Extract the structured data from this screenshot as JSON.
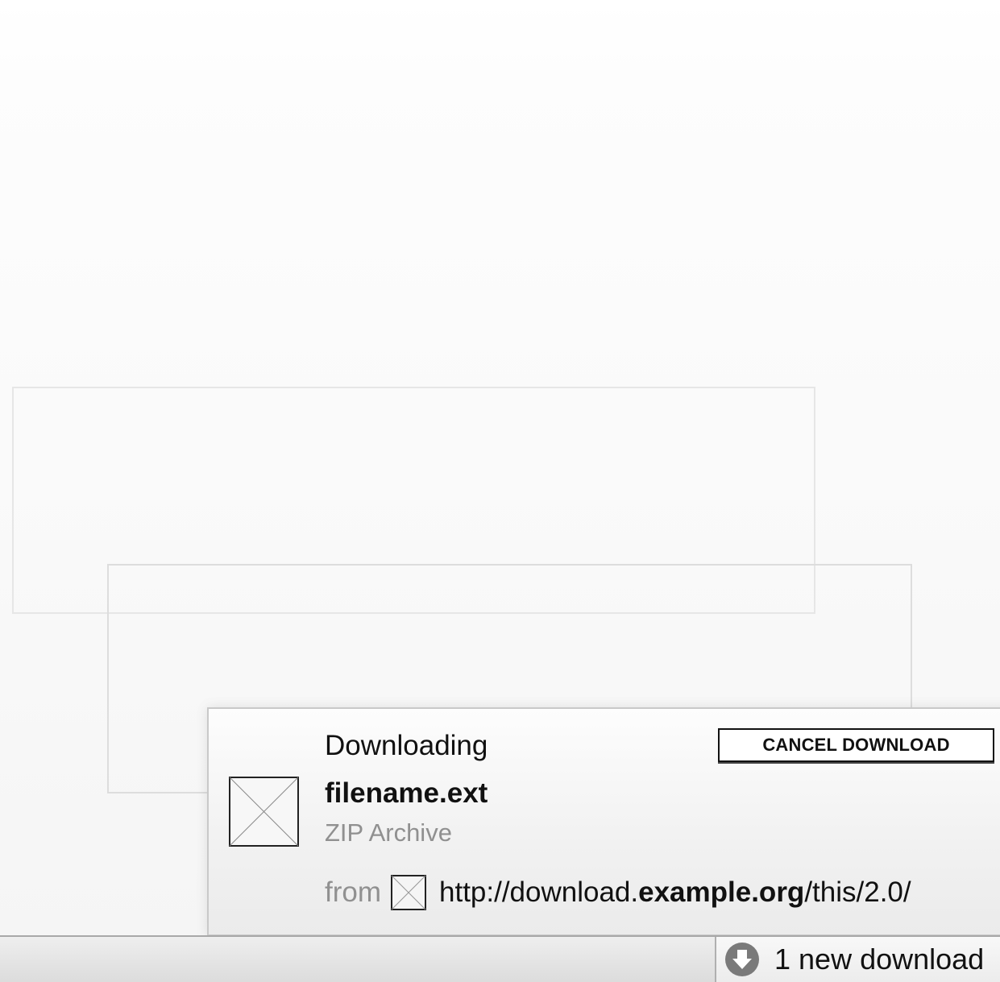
{
  "download_panel": {
    "status": "Downloading",
    "cancel_label": "CANCEL DOWNLOAD",
    "file_name": "filename.ext",
    "file_type": "ZIP Archive",
    "from_label": "from",
    "source": {
      "prefix": "http://download.",
      "domain": "example.org",
      "path": "/this/2.0/"
    },
    "file_icon": "placeholder-image-icon",
    "favicon": "placeholder-favicon-icon"
  },
  "statusbar": {
    "downloads_label": "1 new download",
    "downloads_icon": "download-arrow-icon",
    "icon_color": "#7a7a7a"
  }
}
